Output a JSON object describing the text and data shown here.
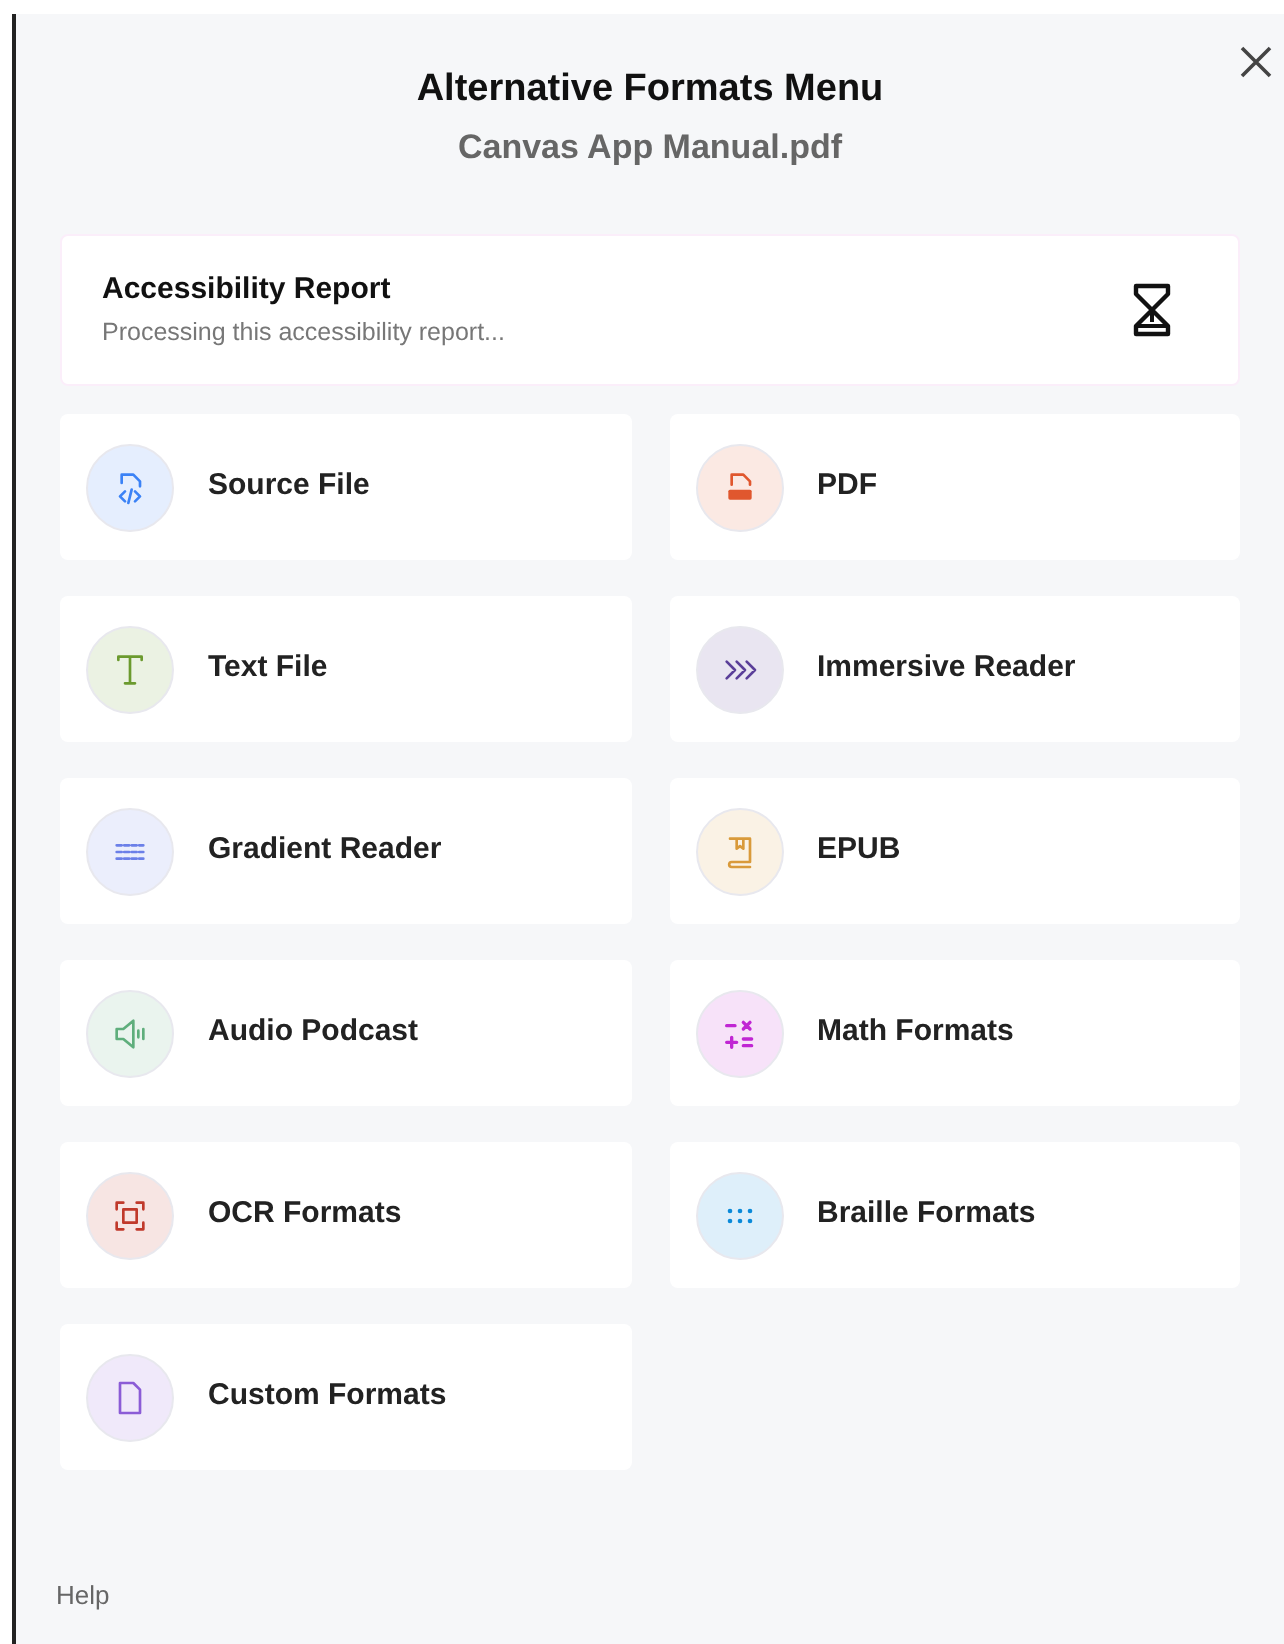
{
  "dialog": {
    "title": "Alternative Formats Menu",
    "subtitle": "Canvas App Manual.pdf"
  },
  "report": {
    "title": "Accessibility Report",
    "status": "Processing this accessibility report..."
  },
  "formats": [
    {
      "label": "Source File",
      "color": "#3b82f6"
    },
    {
      "label": "PDF",
      "color": "#e0572e"
    },
    {
      "label": "Text File",
      "color": "#6b9a2e"
    },
    {
      "label": "Immersive Reader",
      "color": "#5b3f99"
    },
    {
      "label": "Gradient Reader",
      "color": "#6b7fe8"
    },
    {
      "label": "EPUB",
      "color": "#d99a3a"
    },
    {
      "label": "Audio Podcast",
      "color": "#5fae7c"
    },
    {
      "label": "Math Formats",
      "color": "#c026d3"
    },
    {
      "label": "OCR Formats",
      "color": "#c0392b"
    },
    {
      "label": "Braille Formats",
      "color": "#0b8ad9"
    },
    {
      "label": "Custom Formats",
      "color": "#8b5cd6"
    }
  ],
  "footer": {
    "help": "Help"
  }
}
